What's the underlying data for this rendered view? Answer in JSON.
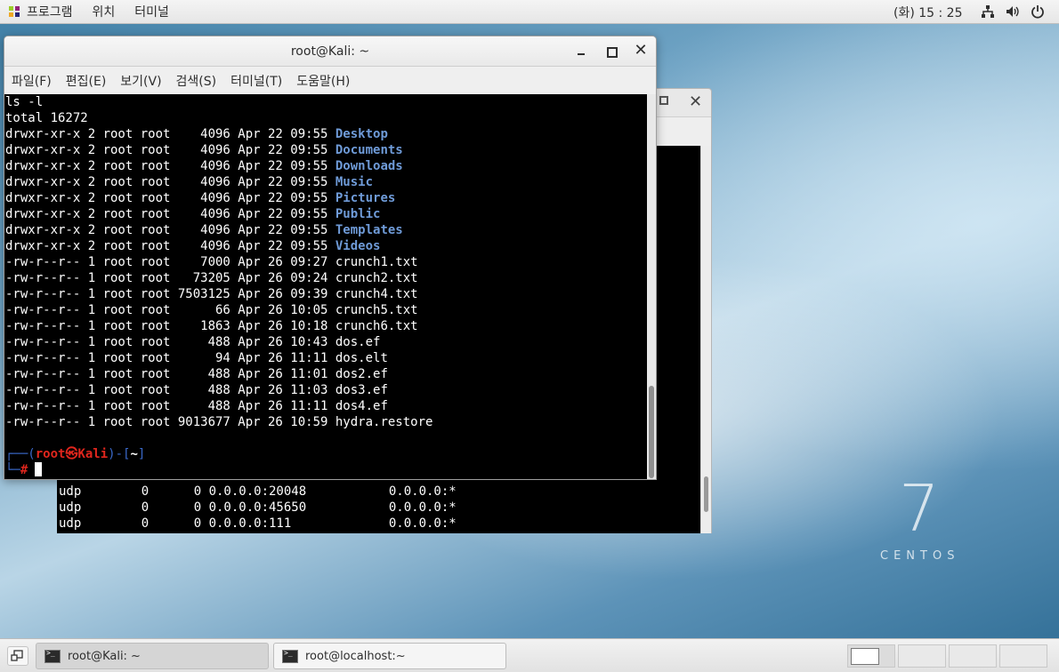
{
  "topbar": {
    "apps_label": "프로그램",
    "places_label": "위치",
    "terminal_label": "터미널",
    "clock": "(화) 15 : 25"
  },
  "desktop": {
    "centos_number": "7",
    "centos_text": "CENTOS"
  },
  "background_window": {
    "lines": [
      "udp        0      0 0.0.0.0:20048           0.0.0.0:*",
      "udp        0      0 0.0.0.0:45650           0.0.0.0:*",
      "udp        0      0 0.0.0.0:111             0.0.0.0:*"
    ]
  },
  "terminal_window": {
    "title": "root@Kali: ~",
    "menu": [
      "파일(F)",
      "편집(E)",
      "보기(V)",
      "검색(S)",
      "터미널(T)",
      "도움말(H)"
    ],
    "command": "ls -l",
    "total": "total 16272",
    "entries": [
      {
        "perm": "drwxr-xr-x",
        "links": "2",
        "owner": "root",
        "group": "root",
        "size": "4096",
        "date": "Apr 22 09:55",
        "name": "Desktop",
        "is_dir": true
      },
      {
        "perm": "drwxr-xr-x",
        "links": "2",
        "owner": "root",
        "group": "root",
        "size": "4096",
        "date": "Apr 22 09:55",
        "name": "Documents",
        "is_dir": true
      },
      {
        "perm": "drwxr-xr-x",
        "links": "2",
        "owner": "root",
        "group": "root",
        "size": "4096",
        "date": "Apr 22 09:55",
        "name": "Downloads",
        "is_dir": true
      },
      {
        "perm": "drwxr-xr-x",
        "links": "2",
        "owner": "root",
        "group": "root",
        "size": "4096",
        "date": "Apr 22 09:55",
        "name": "Music",
        "is_dir": true
      },
      {
        "perm": "drwxr-xr-x",
        "links": "2",
        "owner": "root",
        "group": "root",
        "size": "4096",
        "date": "Apr 22 09:55",
        "name": "Pictures",
        "is_dir": true
      },
      {
        "perm": "drwxr-xr-x",
        "links": "2",
        "owner": "root",
        "group": "root",
        "size": "4096",
        "date": "Apr 22 09:55",
        "name": "Public",
        "is_dir": true
      },
      {
        "perm": "drwxr-xr-x",
        "links": "2",
        "owner": "root",
        "group": "root",
        "size": "4096",
        "date": "Apr 22 09:55",
        "name": "Templates",
        "is_dir": true
      },
      {
        "perm": "drwxr-xr-x",
        "links": "2",
        "owner": "root",
        "group": "root",
        "size": "4096",
        "date": "Apr 22 09:55",
        "name": "Videos",
        "is_dir": true
      },
      {
        "perm": "-rw-r--r--",
        "links": "1",
        "owner": "root",
        "group": "root",
        "size": "7000",
        "date": "Apr 26 09:27",
        "name": "crunch1.txt",
        "is_dir": false
      },
      {
        "perm": "-rw-r--r--",
        "links": "1",
        "owner": "root",
        "group": "root",
        "size": "73205",
        "date": "Apr 26 09:24",
        "name": "crunch2.txt",
        "is_dir": false
      },
      {
        "perm": "-rw-r--r--",
        "links": "1",
        "owner": "root",
        "group": "root",
        "size": "7503125",
        "date": "Apr 26 09:39",
        "name": "crunch4.txt",
        "is_dir": false
      },
      {
        "perm": "-rw-r--r--",
        "links": "1",
        "owner": "root",
        "group": "root",
        "size": "66",
        "date": "Apr 26 10:05",
        "name": "crunch5.txt",
        "is_dir": false
      },
      {
        "perm": "-rw-r--r--",
        "links": "1",
        "owner": "root",
        "group": "root",
        "size": "1863",
        "date": "Apr 26 10:18",
        "name": "crunch6.txt",
        "is_dir": false
      },
      {
        "perm": "-rw-r--r--",
        "links": "1",
        "owner": "root",
        "group": "root",
        "size": "488",
        "date": "Apr 26 10:43",
        "name": "dos.ef",
        "is_dir": false
      },
      {
        "perm": "-rw-r--r--",
        "links": "1",
        "owner": "root",
        "group": "root",
        "size": "94",
        "date": "Apr 26 11:11",
        "name": "dos.elt",
        "is_dir": false
      },
      {
        "perm": "-rw-r--r--",
        "links": "1",
        "owner": "root",
        "group": "root",
        "size": "488",
        "date": "Apr 26 11:01",
        "name": "dos2.ef",
        "is_dir": false
      },
      {
        "perm": "-rw-r--r--",
        "links": "1",
        "owner": "root",
        "group": "root",
        "size": "488",
        "date": "Apr 26 11:03",
        "name": "dos3.ef",
        "is_dir": false
      },
      {
        "perm": "-rw-r--r--",
        "links": "1",
        "owner": "root",
        "group": "root",
        "size": "488",
        "date": "Apr 26 11:11",
        "name": "dos4.ef",
        "is_dir": false
      },
      {
        "perm": "-rw-r--r--",
        "links": "1",
        "owner": "root",
        "group": "root",
        "size": "9013677",
        "date": "Apr 26 10:59",
        "name": "hydra.restore",
        "is_dir": false
      }
    ],
    "prompt": {
      "user": "root",
      "at_symbol": "㉿",
      "host": "Kali",
      "path": "~",
      "symbol": "#"
    }
  },
  "taskbar": {
    "tasks": [
      "root@Kali: ~",
      "root@localhost:~"
    ]
  }
}
